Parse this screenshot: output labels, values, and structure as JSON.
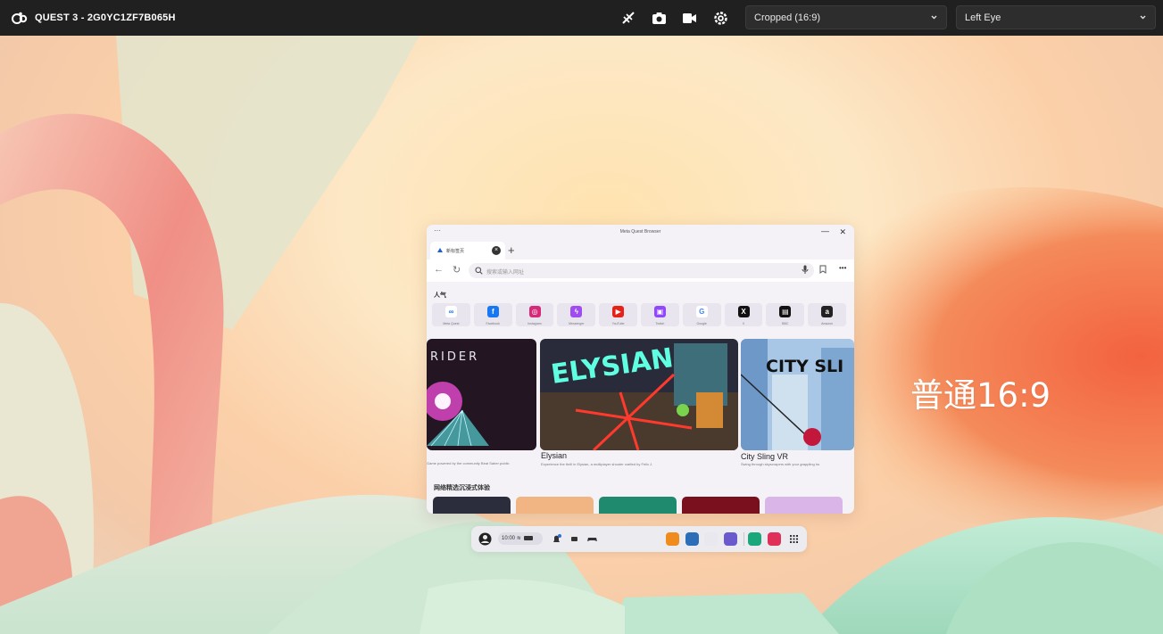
{
  "toolbar": {
    "device_name": "QUEST 3 - 2G0YC1ZF7B065H",
    "view_mode": "Cropped (16:9)",
    "eye": "Left Eye",
    "icons": [
      "quest-logo-icon",
      "stop-cast-icon",
      "screenshot-icon",
      "record-icon",
      "settings-icon"
    ]
  },
  "overlay": {
    "text": "普通16:9"
  },
  "browser": {
    "window_title": "Meta Quest Browser",
    "tab_label": "新标签页",
    "url_placeholder": "搜索或输入网址",
    "popular_label": "人气",
    "shortcuts": [
      {
        "label": "Meta Quest",
        "icon": "meta-icon",
        "color": "#ffffff",
        "fg": "#1877f2",
        "glyph": "∞"
      },
      {
        "label": "Facebook",
        "icon": "facebook-icon",
        "color": "#1877f2",
        "fg": "#ffffff",
        "glyph": "f"
      },
      {
        "label": "Instagram",
        "icon": "instagram-icon",
        "color": "#d6297a",
        "fg": "#ffffff",
        "glyph": "◎"
      },
      {
        "label": "Messenger",
        "icon": "messenger-icon",
        "color": "#a04df0",
        "fg": "#ffffff",
        "glyph": "ϟ"
      },
      {
        "label": "YouTube",
        "icon": "youtube-icon",
        "color": "#e62117",
        "fg": "#ffffff",
        "glyph": "▶"
      },
      {
        "label": "Twitch",
        "icon": "twitch-icon",
        "color": "#9146ff",
        "fg": "#ffffff",
        "glyph": "▣"
      },
      {
        "label": "Google",
        "icon": "google-icon",
        "color": "#ffffff",
        "fg": "#4285f4",
        "glyph": "G"
      },
      {
        "label": "X",
        "icon": "x-icon",
        "color": "#111111",
        "fg": "#ffffff",
        "glyph": "X"
      },
      {
        "label": "BBC",
        "icon": "bbc-icon",
        "color": "#111111",
        "fg": "#ffffff",
        "glyph": "▤"
      },
      {
        "label": "Amazon",
        "icon": "amazon-icon",
        "color": "#222222",
        "fg": "#ffffff",
        "glyph": "a"
      }
    ],
    "cards": [
      {
        "title": "",
        "desc": "Game powered by the community Beat Saber public",
        "banner": "RIDER"
      },
      {
        "title": "Elysian",
        "desc": "Experience the thrill in Elysian, a multiplayer shooter crafted by Felix J.",
        "banner": "ELYSIAN"
      },
      {
        "title": "City Sling VR",
        "desc": "Swing through skyscrapers with your grappling ho",
        "banner": "CITY SLI"
      }
    ],
    "section2_label": "网络精选沉浸式体验",
    "mini_cards": [
      "",
      "",
      "",
      "",
      ""
    ]
  },
  "taskbar": {
    "status": "10:00",
    "apps": [
      {
        "icon": "store-icon",
        "color": "#f08c1e"
      },
      {
        "icon": "gallery-icon",
        "color": "#2c6fb8"
      },
      {
        "icon": "browser-icon",
        "color": "#e8e8ee"
      },
      {
        "icon": "horizon-icon",
        "color": "#6a5acd"
      },
      {
        "icon": "quest-tv-icon",
        "color": "#1aa87a"
      },
      {
        "icon": "camera-icon",
        "color": "#e0305a"
      }
    ]
  }
}
